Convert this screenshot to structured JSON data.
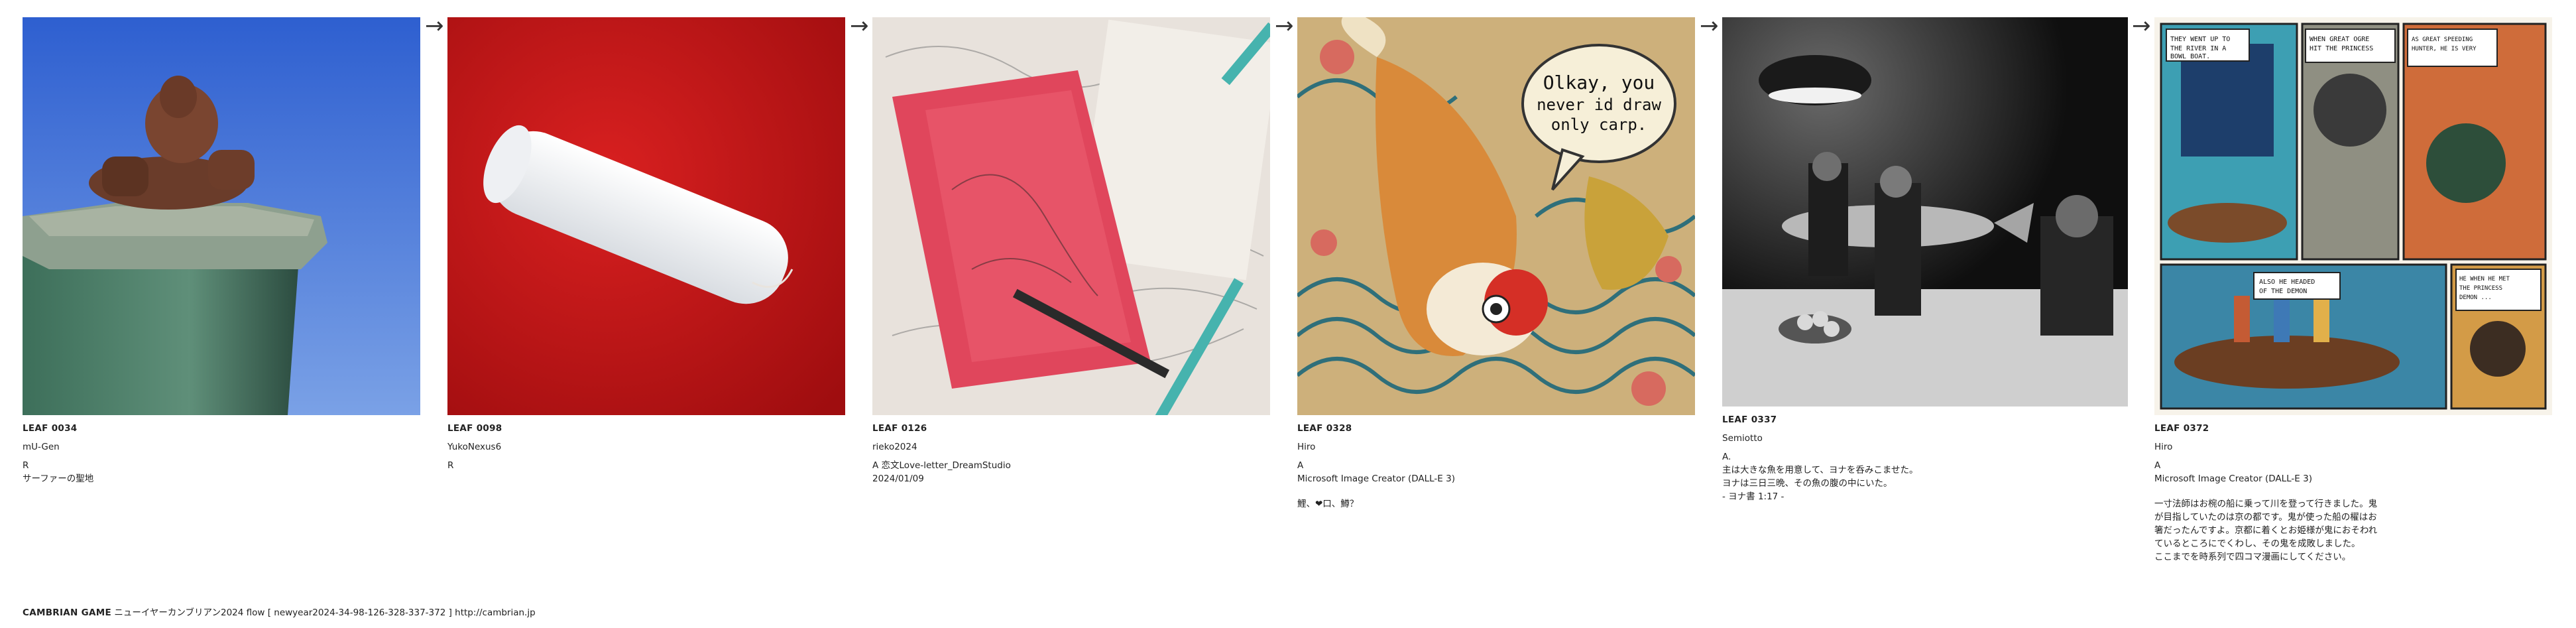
{
  "leaves": [
    {
      "id": "LEAF 0034",
      "author": "mU-Gen",
      "line1": "R",
      "line2": "サーファーの聖地"
    },
    {
      "id": "LEAF 0098",
      "author": "YukoNexus6",
      "line1": "R"
    },
    {
      "id": "LEAF 0126",
      "author": "rieko2024",
      "line1": "A 恋文Love-letter_DreamStudio",
      "line2": "2024/01/09"
    },
    {
      "id": "LEAF 0328",
      "author": "Hiro",
      "line1": "A",
      "line2": "Microsoft Image Creator (DALL-E 3)",
      "extra": "鯉、❤︎口、鱒？"
    },
    {
      "id": "LEAF 0337",
      "author": "Semiotto",
      "line1": "A.",
      "line2": "主は大きな魚を用意して、ヨナを呑みこませた。\nヨナは三日三晩、その魚の腹の中にいた。\n- ヨナ書 1:17 -"
    },
    {
      "id": "LEAF 0372",
      "author": "Hiro",
      "line1": "A",
      "line2": "Microsoft Image Creator (DALL-E 3)",
      "extra": "一寸法師はお椀の船に乗って川を登って行きました。鬼\nが目指していたのは京の都です。鬼が使った船の櫂はお\n箸だったんですよ。京都に着くとお姫様が鬼におそわれ\nているところにでくわし、その鬼を成敗しました。\nここまでを時系列で四コマ漫画にしてください。"
    }
  ],
  "comic_text": [
    "THEY WENT UP TO THE RIVER IN A BOWL BOAT.",
    "WHEN GREAT OGRE HIT THE PRINCESS WHERE PRINCESS",
    "AS GREAT SPEEDING HUNTER, HE IS VERY DAZZLED ON THE RIVER",
    "ALSO HE HEADED OF THE DEMON",
    "HE WHEN HE MET THE PRINCESS DEMON ..."
  ],
  "speech_bubble": "Olkay, you never id draw only carp.",
  "footer": {
    "brand": "CAMBRIAN GAME",
    "text": "ニューイヤーカンブリアン2024  flow [ newyear2024-34-98-126-328-337-372 ]    http://cambrian.jp"
  },
  "arrow_glyph": "→",
  "colors": {
    "accent_red": "#c8161a",
    "sky_blue": "#3f6fd8",
    "text": "#222222"
  }
}
